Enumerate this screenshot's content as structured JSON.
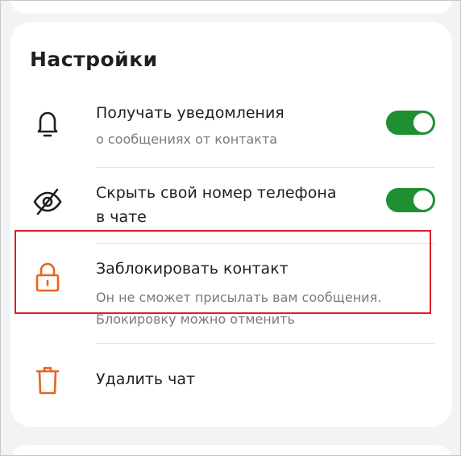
{
  "settings": {
    "title": "Настройки",
    "notifications": {
      "icon": "bell-icon",
      "title": "Получать уведомления",
      "subtitle": "о сообщениях от контакта",
      "enabled": true
    },
    "hide_phone": {
      "icon": "eye-off-icon",
      "title_line1": "Скрыть свой номер телефона",
      "title_line2": "в чате",
      "enabled": true
    },
    "block": {
      "icon": "lock-icon",
      "title": "Заблокировать контакт",
      "subtitle_line1": "Он не сможет присылать вам сообщения.",
      "subtitle_line2": "Блокировку можно отменить"
    },
    "delete": {
      "icon": "trash-icon",
      "title": "Удалить чат"
    }
  },
  "colors": {
    "toggle_on": "#1f8f33",
    "danger_icon": "#e8641b",
    "highlight_border": "#e01e26"
  }
}
